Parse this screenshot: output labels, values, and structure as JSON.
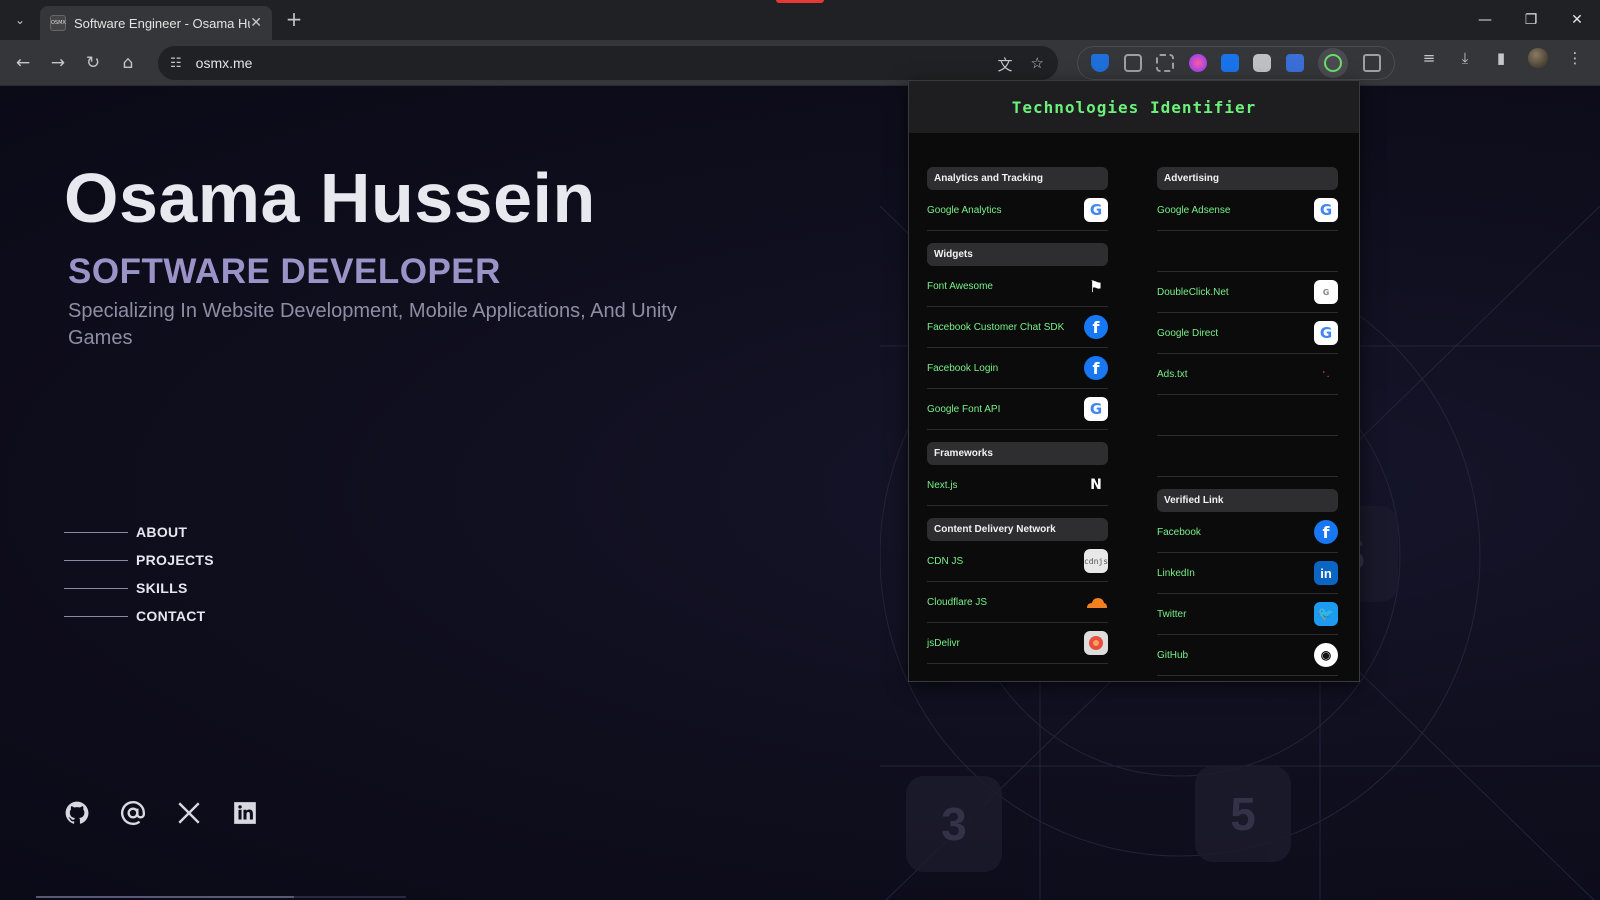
{
  "browser": {
    "tab_title": "Software Engineer - Osama Hussein",
    "favicon_text": "OSMX",
    "url": "osmx.me",
    "icons": {
      "tab_menu": "chevron-down-icon",
      "close": "close-icon",
      "new_tab": "plus-icon",
      "back": "back-arrow-icon",
      "forward": "forward-arrow-icon",
      "reload": "reload-icon",
      "home": "home-icon",
      "site_info": "tune-icon",
      "translate": "translate-icon",
      "bookmark": "star-icon"
    }
  },
  "hero": {
    "name": "Osama Hussein",
    "role": "SOFTWARE DEVELOPER",
    "description": "Specializing In Website Development, Mobile Applications, And Unity Games"
  },
  "nav": {
    "items": [
      {
        "label": "ABOUT"
      },
      {
        "label": "PROJECTS"
      },
      {
        "label": "SKILLS"
      },
      {
        "label": "CONTACT"
      }
    ]
  },
  "socials": [
    "github-icon",
    "email-at-icon",
    "x-twitter-icon",
    "linkedin-icon"
  ],
  "background_tiles": {
    "css": "3",
    "html": "5",
    "aws": "S"
  },
  "popup": {
    "title": "Technologies Identifier",
    "left": {
      "analytics": {
        "category": "Analytics and Tracking",
        "items": [
          {
            "name": "Google Analytics",
            "logo": "G"
          }
        ]
      },
      "widgets": {
        "category": "Widgets",
        "items": [
          {
            "name": "Font Awesome",
            "logo": "⚑"
          },
          {
            "name": "Facebook Customer Chat SDK",
            "logo": "f"
          },
          {
            "name": "Facebook Login",
            "logo": "f"
          },
          {
            "name": "Google Font API",
            "logo": "G"
          }
        ]
      },
      "frameworks": {
        "category": "Frameworks",
        "items": [
          {
            "name": "Next.js",
            "logo": "N"
          }
        ]
      },
      "cdn": {
        "category": "Content Delivery Network",
        "items": [
          {
            "name": "CDN JS",
            "logo": "cdnjs"
          },
          {
            "name": "Cloudflare JS",
            "logo": ""
          },
          {
            "name": "jsDelivr",
            "logo": ""
          }
        ]
      }
    },
    "right": {
      "advertising": {
        "category": "Advertising",
        "items": [
          {
            "name": "Google Adsense",
            "logo": "G"
          },
          {
            "name": "DoubleClick.Net",
            "logo": "G"
          },
          {
            "name": "Google Direct",
            "logo": "G"
          },
          {
            "name": "Ads.txt",
            "logo": "'  ."
          }
        ]
      },
      "verified": {
        "category": "Verified Link",
        "items": [
          {
            "name": "Facebook",
            "logo": "f"
          },
          {
            "name": "LinkedIn",
            "logo": "in"
          },
          {
            "name": "Twitter",
            "logo": "🐦"
          },
          {
            "name": "GitHub",
            "logo": "◉"
          }
        ]
      }
    }
  },
  "colors": {
    "accent_green": "#6bf07a",
    "role_purple": "#9b93c7",
    "page_bg": "#0e0d1c"
  }
}
